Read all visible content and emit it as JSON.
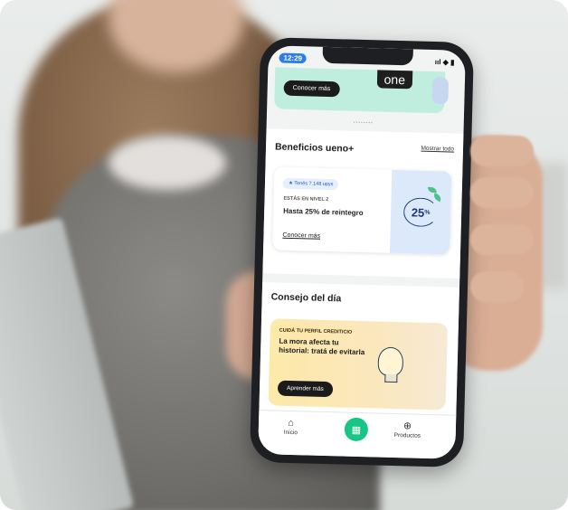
{
  "status": {
    "time": "12:29",
    "signal": "ııl ◆ ▮"
  },
  "top_card": {
    "button_label": "Conocer más",
    "logo_text": "one"
  },
  "pager_text": "••••••••",
  "benefits": {
    "title": "Beneficios ueno+",
    "see_all": "Mostrar todo",
    "badge": "★ Tenés 7.148 upys",
    "level": "ESTÁS EN NIVEL 2",
    "headline": "Hasta 25% de reintegro",
    "link": "Conocer más",
    "percent": "25",
    "percent_sign": "%"
  },
  "tip": {
    "section_title": "Consejo del día",
    "kicker": "CUIDÁ TU PERFIL CREDITICIO",
    "title": "La mora afecta tu historial: tratá de evitarla",
    "button": "Aprender más"
  },
  "tabbar": {
    "home_label": "Inicio",
    "products_label": "Productos"
  },
  "colors": {
    "accent_green": "#19c585",
    "mint": "#bfeede",
    "tip_yellow": "#fde9a8"
  }
}
